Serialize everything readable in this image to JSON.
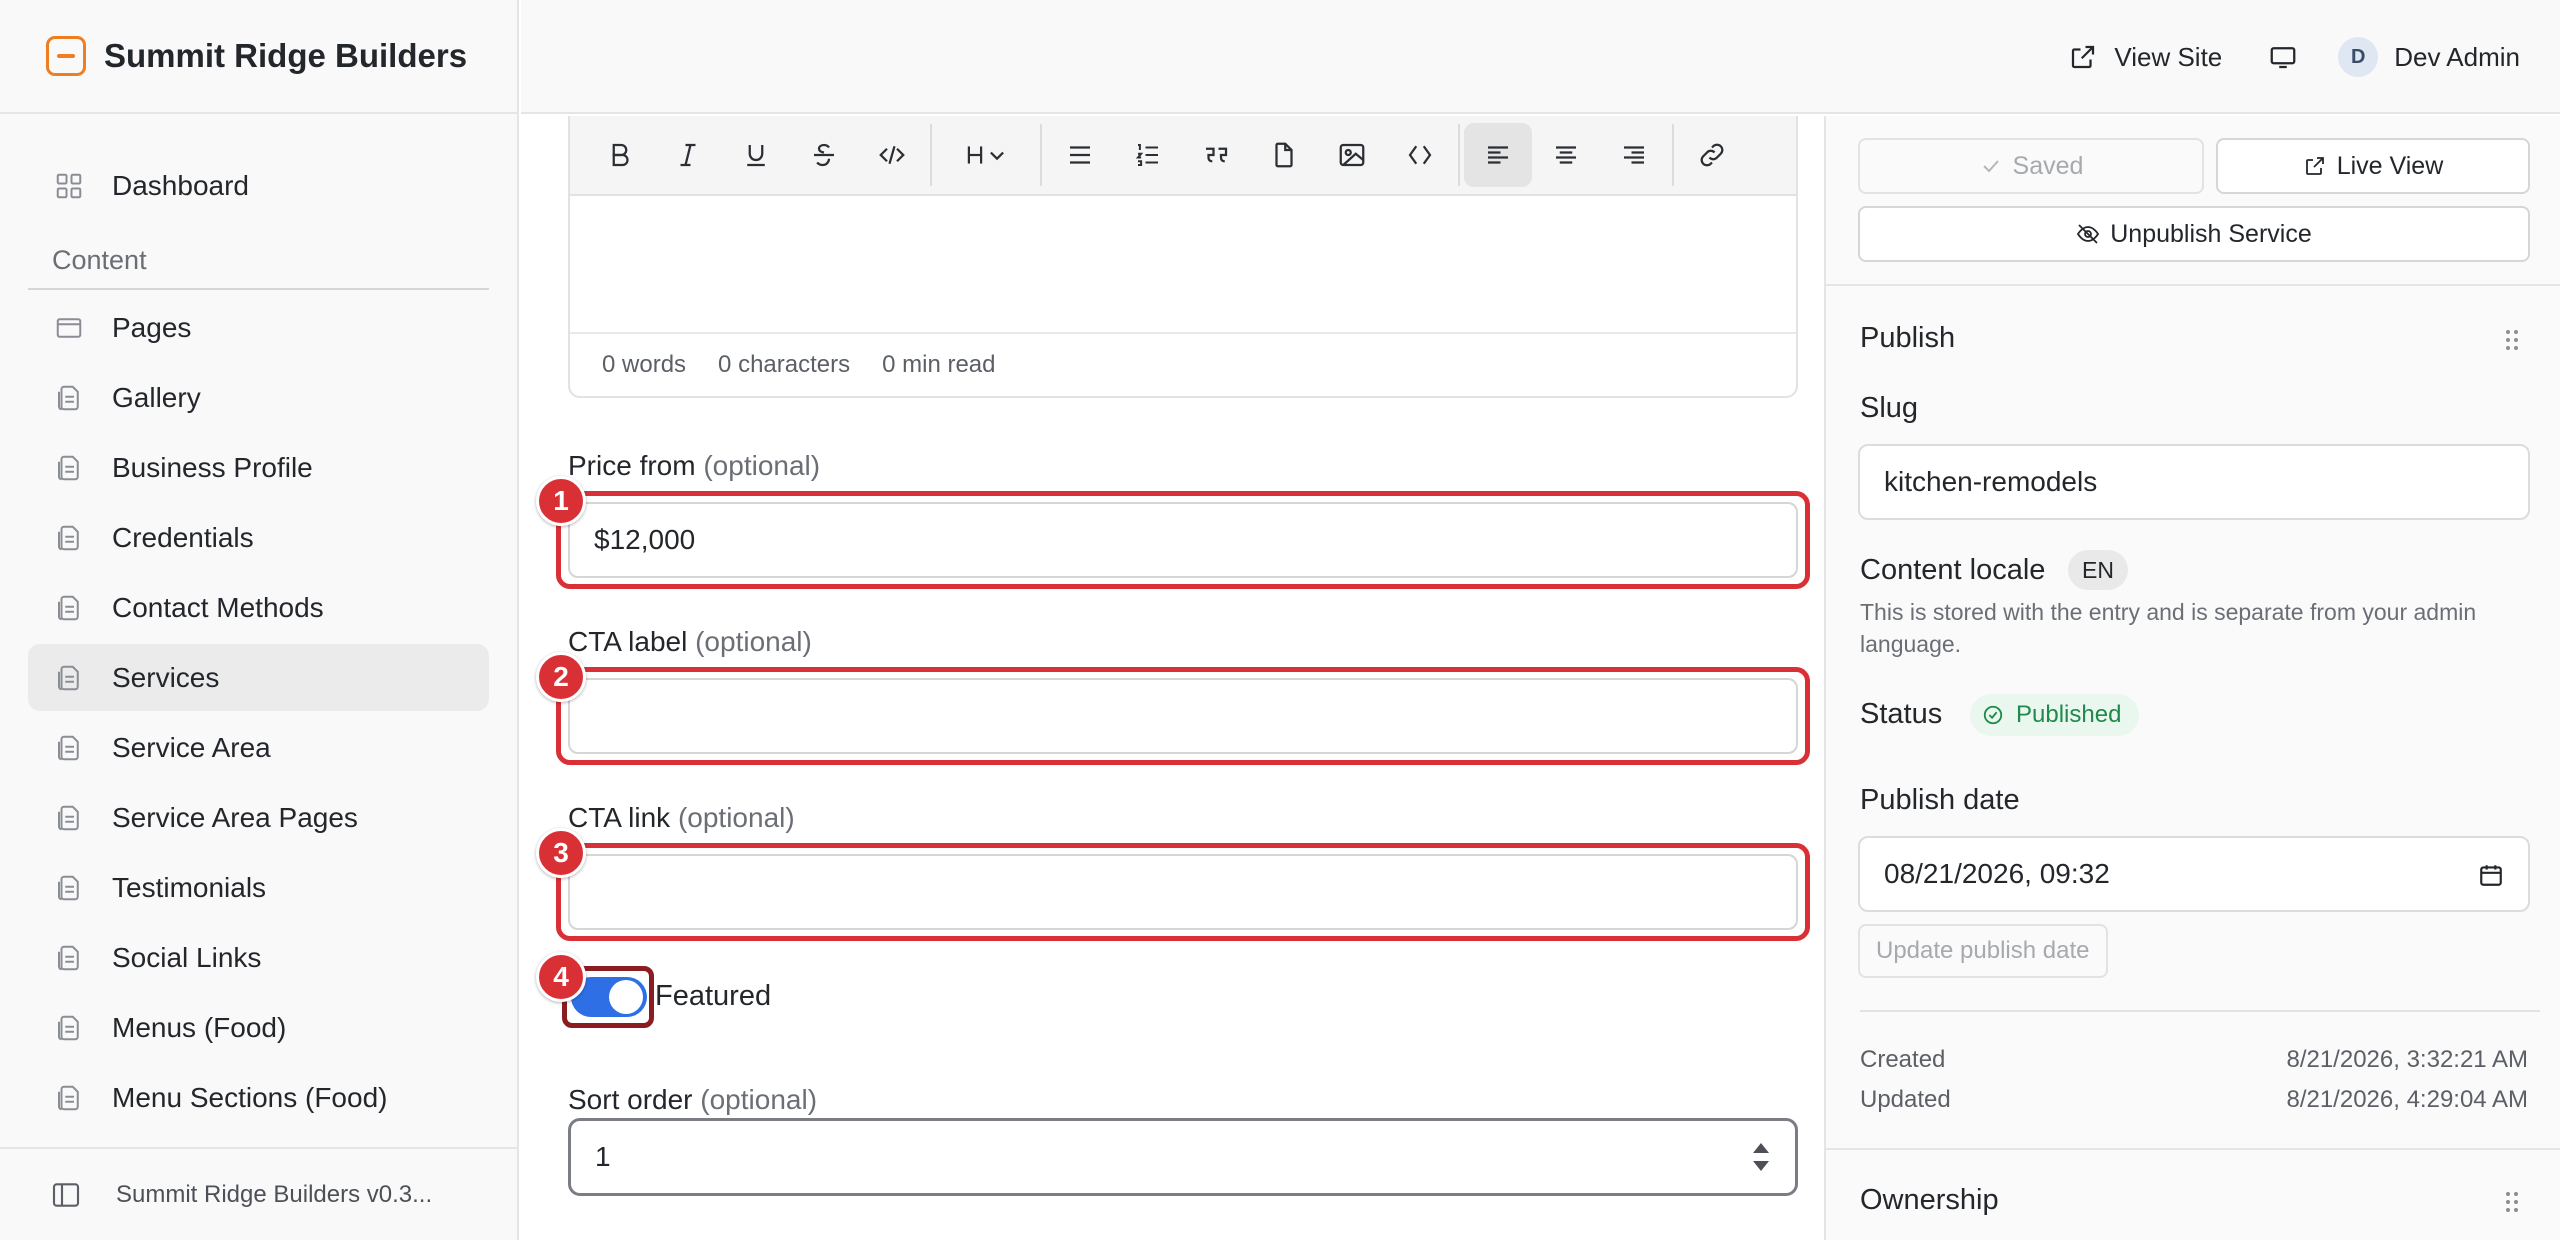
{
  "app": {
    "name": "Summit Ridge Builders",
    "version_label": "Summit Ridge Builders v0.3..."
  },
  "topbar": {
    "view_site_label": "View Site",
    "user_initial": "D",
    "user_name": "Dev Admin"
  },
  "sidebar": {
    "dashboard_label": "Dashboard",
    "section_label": "Content",
    "items": [
      {
        "label": "Pages",
        "icon": "page-icon"
      },
      {
        "label": "Gallery",
        "icon": "document-icon"
      },
      {
        "label": "Business Profile",
        "icon": "document-icon"
      },
      {
        "label": "Credentials",
        "icon": "document-icon"
      },
      {
        "label": "Contact Methods",
        "icon": "document-icon"
      },
      {
        "label": "Services",
        "icon": "document-icon",
        "active": true
      },
      {
        "label": "Service Area",
        "icon": "document-icon"
      },
      {
        "label": "Service Area Pages",
        "icon": "document-icon"
      },
      {
        "label": "Testimonials",
        "icon": "document-icon"
      },
      {
        "label": "Social Links",
        "icon": "document-icon"
      },
      {
        "label": "Menus (Food)",
        "icon": "document-icon"
      },
      {
        "label": "Menu Sections (Food)",
        "icon": "document-icon"
      }
    ]
  },
  "editor": {
    "words": "0 words",
    "characters": "0 characters",
    "read_time": "0 min read"
  },
  "form": {
    "price": {
      "label": "Price from",
      "optional": "(optional)",
      "value": "$12,000",
      "marker": "1"
    },
    "cta_label": {
      "label": "CTA label",
      "optional": "(optional)",
      "value": "",
      "marker": "2"
    },
    "cta_link": {
      "label": "CTA link",
      "optional": "(optional)",
      "value": "",
      "marker": "3"
    },
    "featured": {
      "label": "Featured",
      "checked": true,
      "marker": "4"
    },
    "sort_order": {
      "label": "Sort order",
      "optional": "(optional)",
      "value": "1"
    }
  },
  "panel": {
    "saved_label": "Saved",
    "live_view_label": "Live View",
    "unpublish_label": "Unpublish Service",
    "publish_title": "Publish",
    "slug_label": "Slug",
    "slug_value": "kitchen-remodels",
    "locale_label": "Content locale",
    "locale_value": "EN",
    "locale_hint": "This is stored with the entry and is separate from your admin language.",
    "status_label": "Status",
    "status_value": "Published",
    "publish_date_label": "Publish date",
    "publish_date_value": "08/21/2026, 09:32",
    "update_date_label": "Update publish date",
    "created_label": "Created",
    "created_value": "8/21/2026, 3:32:21 AM",
    "updated_label": "Updated",
    "updated_value": "8/21/2026, 4:29:04 AM",
    "ownership_title": "Ownership"
  },
  "colors": {
    "accent": "#2f6fe6",
    "brand": "#ef7d22",
    "highlight": "#d93036",
    "success": "#1f8a4c"
  }
}
